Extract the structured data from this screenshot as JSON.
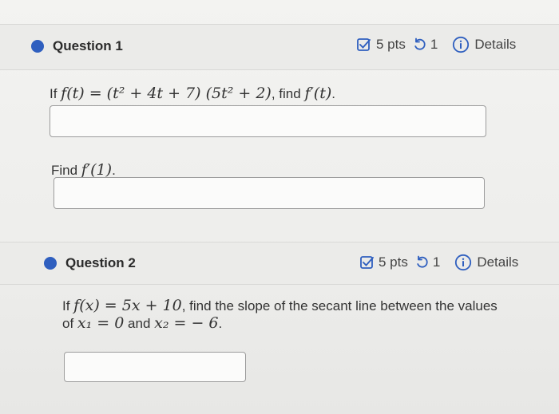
{
  "colors": {
    "accent": "#2f5fbf",
    "header_bg": "#ebebe9",
    "page_bg": "#f2f2f0"
  },
  "questions": [
    {
      "title": "Question 1",
      "points": "5 pts",
      "attempts": "1",
      "details_label": "Details",
      "icons": [
        "checkbox-edit-icon",
        "retry-icon",
        "info-icon"
      ],
      "prompt_prefix": "If ",
      "prompt_math": "f(t) = (t² + 4t + 7) (5t² + 2)",
      "prompt_mid": ", find ",
      "prompt_math2": "f′(t)",
      "prompt_suffix": ".",
      "answer_value": "",
      "sub_prompt_prefix": "Find ",
      "sub_prompt_math": "f′(1)",
      "sub_prompt_suffix": ".",
      "sub_answer_value": ""
    },
    {
      "title": "Question 2",
      "points": "5 pts",
      "attempts": "1",
      "details_label": "Details",
      "icons": [
        "checkbox-edit-icon",
        "retry-icon",
        "info-icon"
      ],
      "line1_prefix": "If ",
      "line1_math": "f(x) = 5x + 10",
      "line1_suffix": ", find the slope of the secant line between the values",
      "line2_prefix": "of ",
      "line2_math1": "x₁ = 0",
      "line2_mid": " and ",
      "line2_math2": "x₂ = − 6",
      "line2_suffix": ".",
      "answer_value": ""
    }
  ]
}
